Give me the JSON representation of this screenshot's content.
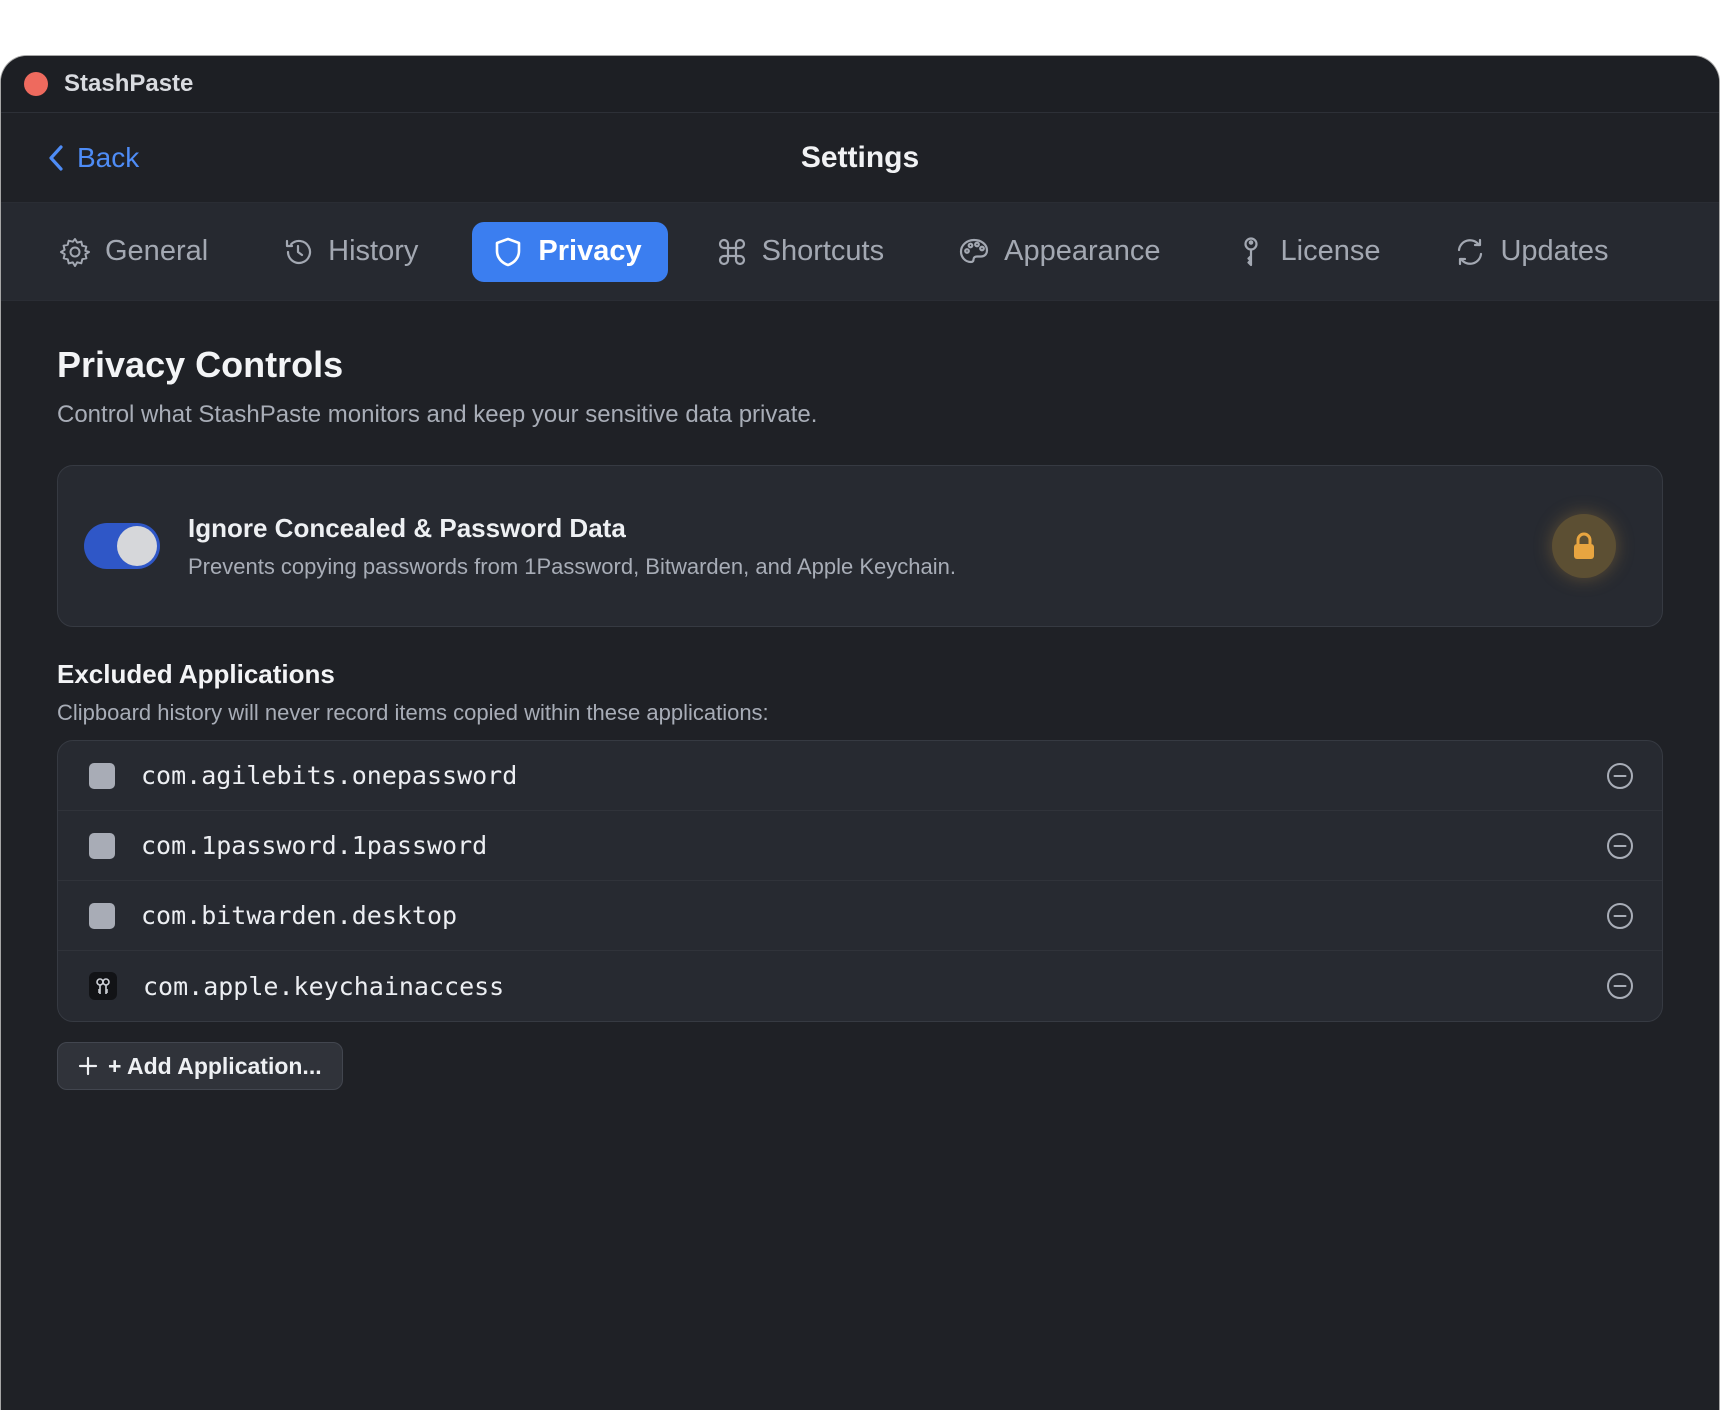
{
  "window": {
    "app_title": "StashPaste"
  },
  "nav": {
    "back_label": "Back",
    "title": "Settings"
  },
  "tabs": [
    {
      "label": "General",
      "icon": "gear-icon"
    },
    {
      "label": "History",
      "icon": "history-icon"
    },
    {
      "label": "Privacy",
      "icon": "shield-icon",
      "active": true
    },
    {
      "label": "Shortcuts",
      "icon": "command-icon"
    },
    {
      "label": "Appearance",
      "icon": "palette-icon"
    },
    {
      "label": "License",
      "icon": "key-icon"
    },
    {
      "label": "Updates",
      "icon": "refresh-icon"
    }
  ],
  "privacy": {
    "title": "Privacy Controls",
    "subtitle": "Control what StashPaste monitors and keep your sensitive data private.",
    "concealed": {
      "title": "Ignore Concealed & Password Data",
      "description": "Prevents copying passwords from 1Password, Bitwarden, and Apple Keychain.",
      "enabled": true
    },
    "excluded": {
      "title": "Excluded Applications",
      "subtitle": "Clipboard history will never record items copied within these applications:",
      "apps": [
        {
          "bundle_id": "com.agilebits.onepassword",
          "icon": "app-placeholder-icon"
        },
        {
          "bundle_id": "com.1password.1password",
          "icon": "app-placeholder-icon"
        },
        {
          "bundle_id": "com.bitwarden.desktop",
          "icon": "app-placeholder-icon"
        },
        {
          "bundle_id": "com.apple.keychainaccess",
          "icon": "keychain-icon"
        }
      ],
      "add_label": "+ Add Application..."
    }
  },
  "colors": {
    "accent": "#3b7ef0",
    "link": "#4e8cf6",
    "background": "#1f2126",
    "toggle_on": "#2f57c7",
    "lock_badge": "#e8a540",
    "close_button": "#ee6a5e"
  }
}
